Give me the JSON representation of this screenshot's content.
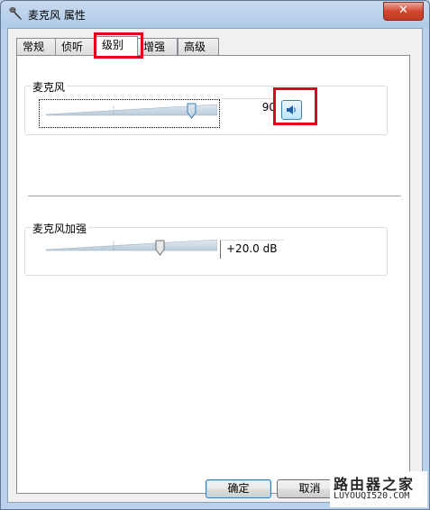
{
  "window": {
    "title": "麦克风 属性",
    "close_glyph": "✕"
  },
  "tabs": [
    {
      "label": "常规",
      "active": false
    },
    {
      "label": "侦听",
      "active": false
    },
    {
      "label": "级别",
      "active": true
    },
    {
      "label": "增强",
      "active": false
    },
    {
      "label": "高级",
      "active": false
    }
  ],
  "microphone": {
    "group_label": "麦克风",
    "value": "90",
    "level": 90,
    "mute_icon": "speaker-icon"
  },
  "boost": {
    "group_label": "麦克风加强",
    "value": "+20.0 dB",
    "level_fraction": 0.67
  },
  "buttons": {
    "ok": "确定",
    "cancel": "取消"
  },
  "watermark": {
    "line1": "路由器之家",
    "line2": "LUYOUQI520.COM"
  },
  "colors": {
    "highlight": "#e0001b",
    "accent": "#3c7fb1"
  }
}
